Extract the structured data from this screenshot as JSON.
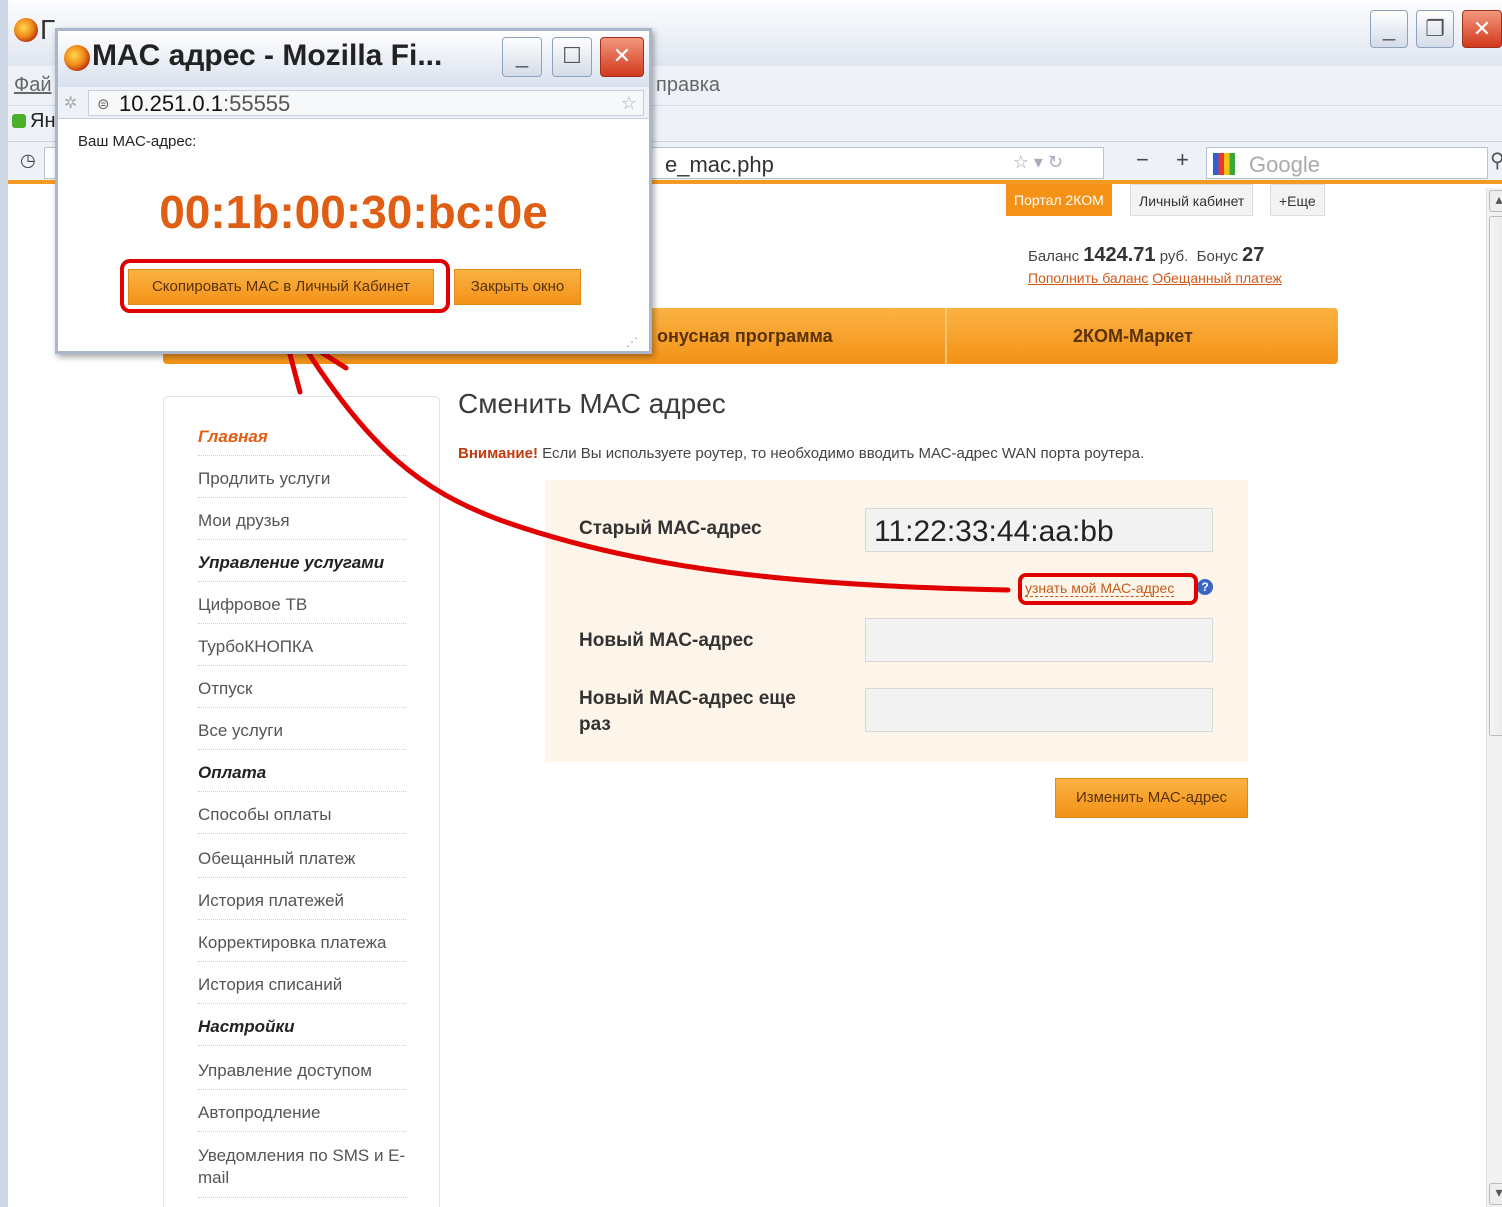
{
  "browser": {
    "title_fragment": "Г",
    "menu_file": "Фай",
    "menu_help_fragment": "правка",
    "bookmark_fragment": "Ян",
    "url_fragment": "e_mac.php",
    "search_placeholder": "Google",
    "zoom_minus": "−",
    "zoom_plus": "+"
  },
  "popup": {
    "title": "MAC адрес - Mozilla Fi...",
    "url_host": "10.251.0.1",
    "url_port": ":55555",
    "label": "Ваш MAC-адрес:",
    "mac": "00:1b:00:30:bc:0e",
    "copy_button": "Скопировать MAC в Личный Кабинет",
    "close_button": "Закрыть окно"
  },
  "header": {
    "toplinks": [
      "Портал 2КОМ",
      "Личный кабинет",
      "+Еще"
    ],
    "balance_label": "Баланс",
    "balance_value": "1424.71",
    "balance_unit": "руб.",
    "bonus_label": "Бонус",
    "bonus_value": "27",
    "topup_link": "Пополнить баланс",
    "promised_link": "Обещанный платеж"
  },
  "nav": {
    "tab_bonus": "онусная программа",
    "tab_market": "2КОМ-Маркет"
  },
  "sidebar": {
    "items": [
      {
        "label": "Главная",
        "kind": "active"
      },
      {
        "label": "Продлить услуги",
        "kind": "item"
      },
      {
        "label": "Мои друзья",
        "kind": "item"
      },
      {
        "label": "Управление услугами",
        "kind": "head"
      },
      {
        "label": "Цифровое ТВ",
        "kind": "item"
      },
      {
        "label": "ТурбоКНОПКА",
        "kind": "item"
      },
      {
        "label": "Отпуск",
        "kind": "item"
      },
      {
        "label": "Все услуги",
        "kind": "item"
      },
      {
        "label": "Оплата",
        "kind": "head"
      },
      {
        "label": "Способы оплаты",
        "kind": "item"
      },
      {
        "label": "Обещанный платеж",
        "kind": "item"
      },
      {
        "label": "История платежей",
        "kind": "item"
      },
      {
        "label": "Корректировка платежа",
        "kind": "item"
      },
      {
        "label": "История списаний",
        "kind": "item"
      },
      {
        "label": "Настройки",
        "kind": "head"
      },
      {
        "label": "Управление доступом",
        "kind": "item"
      },
      {
        "label": "Автопродление",
        "kind": "item"
      },
      {
        "label": "Уведомления по SMS и E-mail",
        "kind": "item"
      }
    ]
  },
  "main": {
    "heading": "Сменить МАС адрес",
    "warning_bold": "Внимание!",
    "warning_text": " Если Вы используете роутер, то необходимо вводить МАС-адрес WAN порта роутера.",
    "old_mac_label": "Старый МАС-адрес",
    "old_mac_value": "11:22:33:44:aa:bb",
    "find_mac_link": "узнать мой МАС-адрес",
    "new_mac_label": "Новый МАС-адрес",
    "new_mac_value": "",
    "new_mac_again_label": "Новый МАС-адрес еще раз",
    "new_mac_again_value": "",
    "submit_button": "Изменить МАС-адрес"
  },
  "colors": {
    "accent_orange": "#f39217",
    "highlight_red": "#e10000",
    "mac_text": "#e05d14"
  }
}
